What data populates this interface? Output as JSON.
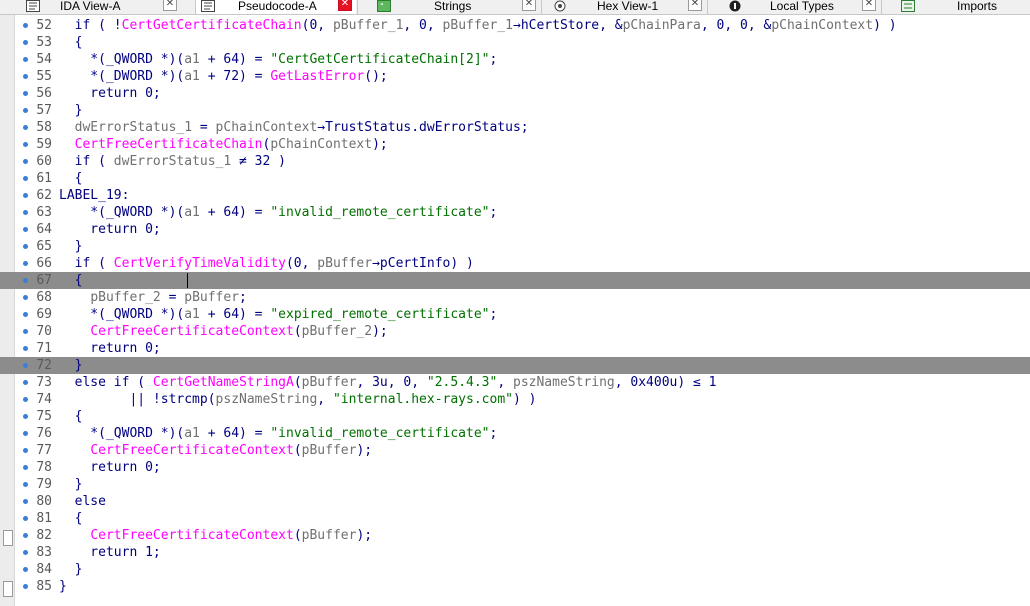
{
  "tabs": [
    {
      "label": "IDA View-A",
      "icon": "disassembly-view-icon",
      "active": false
    },
    {
      "label": "Pseudocode-A",
      "icon": "pseudocode-icon",
      "active": true
    },
    {
      "label": "Strings",
      "icon": "strings-icon",
      "active": false
    },
    {
      "label": "Hex View-1",
      "icon": "hex-view-icon",
      "active": false
    },
    {
      "label": "Local Types",
      "icon": "local-types-icon",
      "active": false
    },
    {
      "label": "Imports",
      "icon": "imports-icon",
      "active": false
    }
  ],
  "colors": {
    "keyword": "#000080",
    "function": "#ff00ff",
    "string": "#007000",
    "variable": "#707070",
    "highlight": "#8c8c8c",
    "breakpoint_dot": "#3a7fd5"
  },
  "code_lines": [
    {
      "n": "52",
      "hl": false,
      "segs": [
        [
          "  if ( !",
          "kw"
        ],
        [
          "CertGetCertificateChain",
          "fn"
        ],
        [
          "(0, ",
          "kw"
        ],
        [
          "pBuffer_1",
          "vr"
        ],
        [
          ", 0, ",
          "kw"
        ],
        [
          "pBuffer_1",
          "vr"
        ],
        [
          "→hCertStore, &",
          "kw"
        ],
        [
          "pChainPara",
          "vr"
        ],
        [
          ", 0, 0, &",
          "kw"
        ],
        [
          "pChainContext",
          "vr"
        ],
        [
          ") )",
          "kw"
        ]
      ]
    },
    {
      "n": "53",
      "hl": false,
      "segs": [
        [
          "  {",
          "kw"
        ]
      ]
    },
    {
      "n": "54",
      "hl": false,
      "segs": [
        [
          "    *(_QWORD *)(",
          "kw"
        ],
        [
          "a1",
          "vr"
        ],
        [
          " + 64) = ",
          "kw"
        ],
        [
          "\"CertGetCertificateChain[2]\"",
          "st"
        ],
        [
          ";",
          "kw"
        ]
      ]
    },
    {
      "n": "55",
      "hl": false,
      "segs": [
        [
          "    *(_DWORD *)(",
          "kw"
        ],
        [
          "a1",
          "vr"
        ],
        [
          " + 72) = ",
          "kw"
        ],
        [
          "GetLastError",
          "fn"
        ],
        [
          "();",
          "kw"
        ]
      ]
    },
    {
      "n": "56",
      "hl": false,
      "segs": [
        [
          "    return 0;",
          "kw"
        ]
      ]
    },
    {
      "n": "57",
      "hl": false,
      "segs": [
        [
          "  }",
          "kw"
        ]
      ]
    },
    {
      "n": "58",
      "hl": false,
      "segs": [
        [
          "  ",
          "kw"
        ],
        [
          "dwErrorStatus_1",
          "vr"
        ],
        [
          " = ",
          "kw"
        ],
        [
          "pChainContext",
          "vr"
        ],
        [
          "→TrustStatus.dwErrorStatus;",
          "kw"
        ]
      ]
    },
    {
      "n": "59",
      "hl": false,
      "segs": [
        [
          "  ",
          "kw"
        ],
        [
          "CertFreeCertificateChain",
          "fn"
        ],
        [
          "(",
          "kw"
        ],
        [
          "pChainContext",
          "vr"
        ],
        [
          ");",
          "kw"
        ]
      ]
    },
    {
      "n": "60",
      "hl": false,
      "segs": [
        [
          "  if ( ",
          "kw"
        ],
        [
          "dwErrorStatus_1",
          "vr"
        ],
        [
          " ≠ 32 )",
          "kw"
        ]
      ]
    },
    {
      "n": "61",
      "hl": false,
      "segs": [
        [
          "  {",
          "kw"
        ]
      ]
    },
    {
      "n": "62",
      "hl": false,
      "segs": [
        [
          "LABEL_19:",
          "lb"
        ]
      ]
    },
    {
      "n": "63",
      "hl": false,
      "segs": [
        [
          "    *(_QWORD *)(",
          "kw"
        ],
        [
          "a1",
          "vr"
        ],
        [
          " + 64) = ",
          "kw"
        ],
        [
          "\"invalid_remote_certificate\"",
          "st"
        ],
        [
          ";",
          "kw"
        ]
      ]
    },
    {
      "n": "64",
      "hl": false,
      "segs": [
        [
          "    return 0;",
          "kw"
        ]
      ]
    },
    {
      "n": "65",
      "hl": false,
      "segs": [
        [
          "  }",
          "kw"
        ]
      ]
    },
    {
      "n": "66",
      "hl": false,
      "segs": [
        [
          "  if ( ",
          "kw"
        ],
        [
          "CertVerifyTimeValidity",
          "fn"
        ],
        [
          "(0, ",
          "kw"
        ],
        [
          "pBuffer",
          "vr"
        ],
        [
          "→pCertInfo) )",
          "kw"
        ]
      ]
    },
    {
      "n": "67",
      "hl": true,
      "segs": [
        [
          "  {",
          "kw"
        ]
      ]
    },
    {
      "n": "68",
      "hl": false,
      "segs": [
        [
          "    ",
          "kw"
        ],
        [
          "pBuffer_2",
          "vr"
        ],
        [
          " = ",
          "kw"
        ],
        [
          "pBuffer",
          "vr"
        ],
        [
          ";",
          "kw"
        ]
      ]
    },
    {
      "n": "69",
      "hl": false,
      "segs": [
        [
          "    *(_QWORD *)(",
          "kw"
        ],
        [
          "a1",
          "vr"
        ],
        [
          " + 64) = ",
          "kw"
        ],
        [
          "\"expired_remote_certificate\"",
          "st"
        ],
        [
          ";",
          "kw"
        ]
      ]
    },
    {
      "n": "70",
      "hl": false,
      "segs": [
        [
          "    ",
          "kw"
        ],
        [
          "CertFreeCertificateContext",
          "fn"
        ],
        [
          "(",
          "kw"
        ],
        [
          "pBuffer_2",
          "vr"
        ],
        [
          ");",
          "kw"
        ]
      ]
    },
    {
      "n": "71",
      "hl": false,
      "segs": [
        [
          "    return 0;",
          "kw"
        ]
      ]
    },
    {
      "n": "72",
      "hl": true,
      "segs": [
        [
          "  }",
          "kw"
        ]
      ]
    },
    {
      "n": "73",
      "hl": false,
      "segs": [
        [
          "  else if ( ",
          "kw"
        ],
        [
          "CertGetNameStringA",
          "fn"
        ],
        [
          "(",
          "kw"
        ],
        [
          "pBuffer",
          "vr"
        ],
        [
          ", 3u, 0, ",
          "kw"
        ],
        [
          "\"2.5.4.3\"",
          "st"
        ],
        [
          ", ",
          "kw"
        ],
        [
          "pszNameString",
          "vr"
        ],
        [
          ", 0x400u) ≤ 1",
          "kw"
        ]
      ]
    },
    {
      "n": "74",
      "hl": false,
      "segs": [
        [
          "         || !strcmp(",
          "kw"
        ],
        [
          "pszNameString",
          "vr"
        ],
        [
          ", ",
          "kw"
        ],
        [
          "\"internal.hex-rays.com\"",
          "st"
        ],
        [
          ") )",
          "kw"
        ]
      ]
    },
    {
      "n": "75",
      "hl": false,
      "segs": [
        [
          "  {",
          "kw"
        ]
      ]
    },
    {
      "n": "76",
      "hl": false,
      "segs": [
        [
          "    *(_QWORD *)(",
          "kw"
        ],
        [
          "a1",
          "vr"
        ],
        [
          " + 64) = ",
          "kw"
        ],
        [
          "\"invalid_remote_certificate\"",
          "st"
        ],
        [
          ";",
          "kw"
        ]
      ]
    },
    {
      "n": "77",
      "hl": false,
      "segs": [
        [
          "    ",
          "kw"
        ],
        [
          "CertFreeCertificateContext",
          "fn"
        ],
        [
          "(",
          "kw"
        ],
        [
          "pBuffer",
          "vr"
        ],
        [
          ");",
          "kw"
        ]
      ]
    },
    {
      "n": "78",
      "hl": false,
      "segs": [
        [
          "    return 0;",
          "kw"
        ]
      ]
    },
    {
      "n": "79",
      "hl": false,
      "segs": [
        [
          "  }",
          "kw"
        ]
      ]
    },
    {
      "n": "80",
      "hl": false,
      "segs": [
        [
          "  else",
          "kw"
        ]
      ]
    },
    {
      "n": "81",
      "hl": false,
      "segs": [
        [
          "  {",
          "kw"
        ]
      ]
    },
    {
      "n": "82",
      "hl": false,
      "segs": [
        [
          "    ",
          "kw"
        ],
        [
          "CertFreeCertificateContext",
          "fn"
        ],
        [
          "(",
          "kw"
        ],
        [
          "pBuffer",
          "vr"
        ],
        [
          ");",
          "kw"
        ]
      ]
    },
    {
      "n": "83",
      "hl": false,
      "segs": [
        [
          "    return 1;",
          "kw"
        ]
      ]
    },
    {
      "n": "84",
      "hl": false,
      "segs": [
        [
          "  }",
          "kw"
        ]
      ]
    },
    {
      "n": "85",
      "hl": false,
      "segs": [
        [
          "}",
          "kw"
        ]
      ]
    }
  ]
}
